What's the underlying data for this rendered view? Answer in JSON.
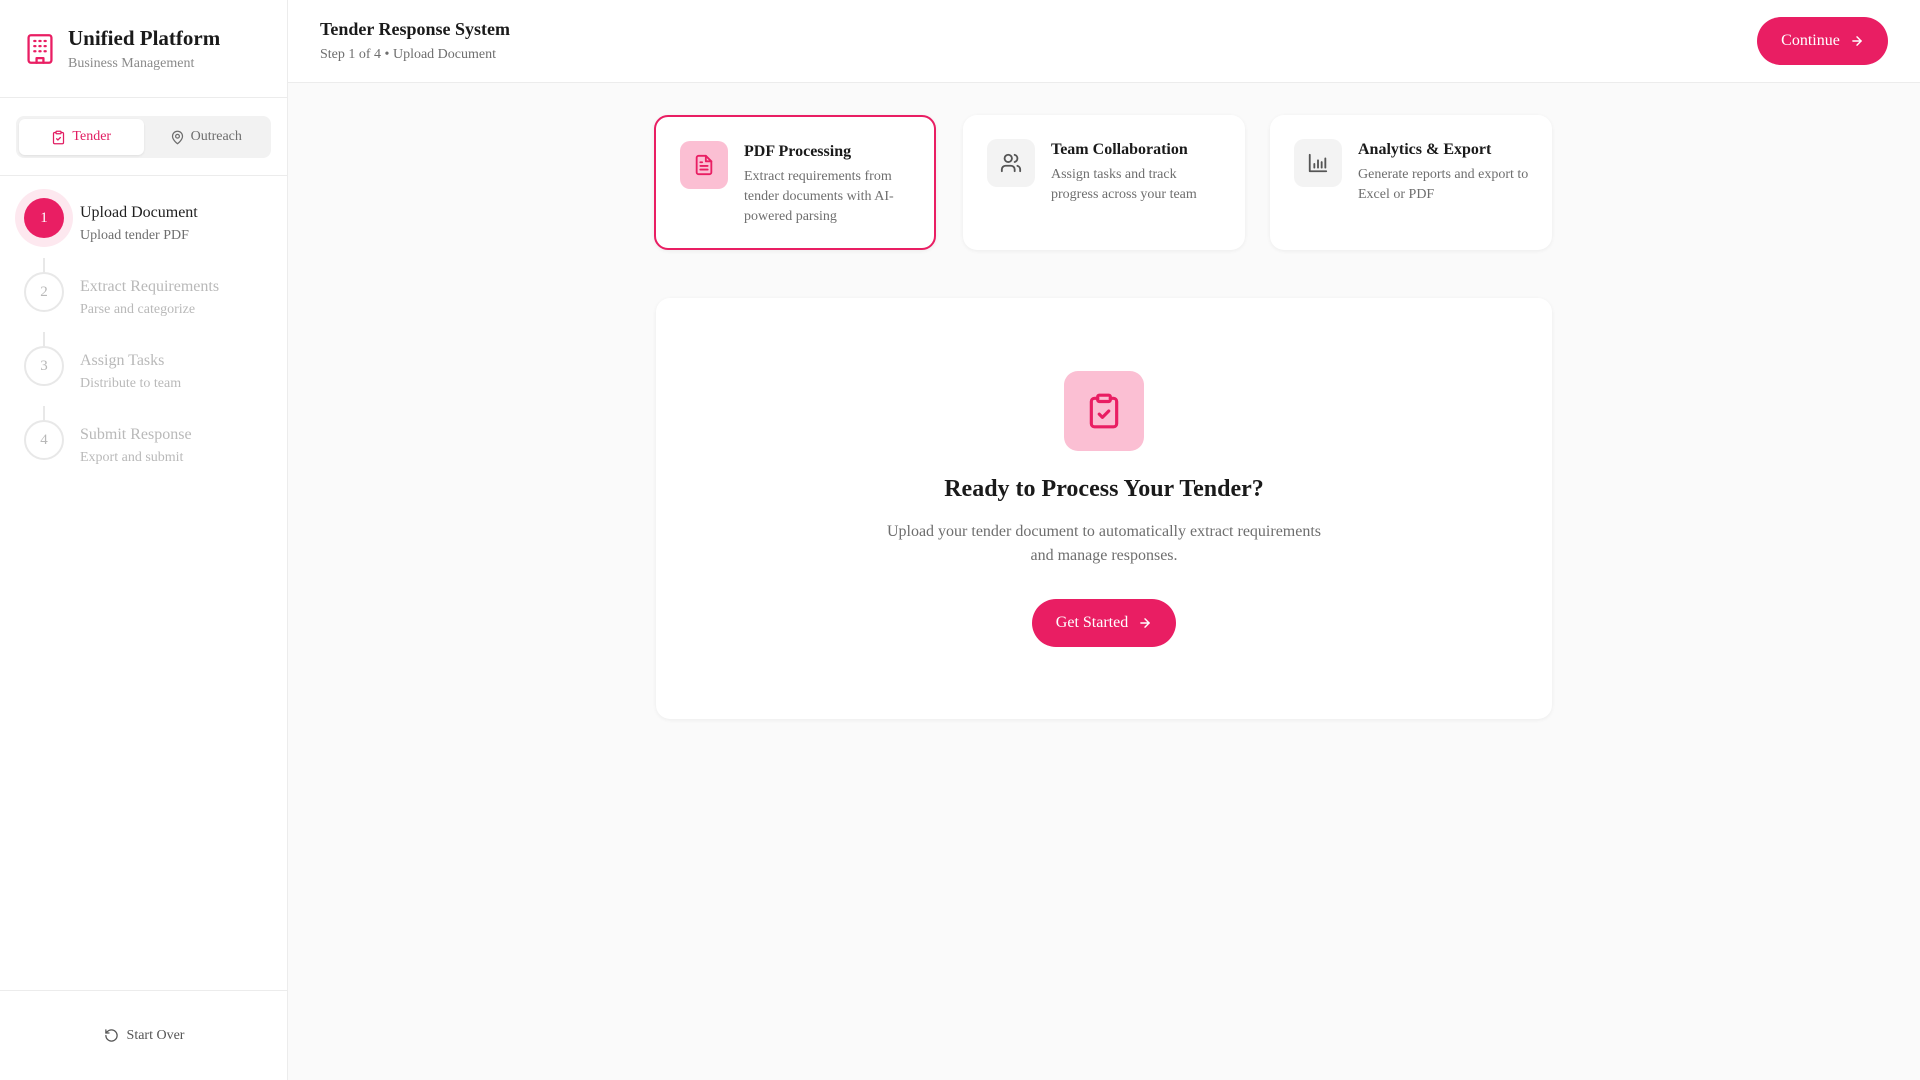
{
  "app": {
    "name": "Unified Platform",
    "subtitle": "Business Management",
    "brand_color": "#e91e63"
  },
  "module_switch": {
    "options": [
      {
        "label": "Tender",
        "icon": "clipboard-check-icon",
        "active": true
      },
      {
        "label": "Outreach",
        "icon": "map-pin-icon",
        "active": false
      }
    ]
  },
  "steps": [
    {
      "number": "1",
      "title": "Upload Document",
      "subtitle": "Upload tender PDF",
      "state": "active"
    },
    {
      "number": "2",
      "title": "Extract Requirements",
      "subtitle": "Parse and categorize",
      "state": "pending"
    },
    {
      "number": "3",
      "title": "Assign Tasks",
      "subtitle": "Distribute to team",
      "state": "pending"
    },
    {
      "number": "4",
      "title": "Submit Response",
      "subtitle": "Export and submit",
      "state": "pending"
    }
  ],
  "footer": {
    "start_over_label": "Start Over",
    "icon": "rotate-ccw-icon"
  },
  "header": {
    "title": "Tender Response System",
    "subtitle": "Step 1 of 4 • Upload Document",
    "continue_label": "Continue"
  },
  "features": [
    {
      "title": "PDF Processing",
      "description": "Extract requirements from tender documents with AI-powered parsing",
      "icon": "file-text-icon",
      "selected": true
    },
    {
      "title": "Team Collaboration",
      "description": "Assign tasks and track progress across your team",
      "icon": "users-icon",
      "selected": false
    },
    {
      "title": "Analytics & Export",
      "description": "Generate reports and export to Excel or PDF",
      "icon": "bar-chart-icon",
      "selected": false
    }
  ],
  "hero": {
    "icon": "clipboard-check-icon",
    "title": "Ready to Process Your Tender?",
    "description": "Upload your tender document to automatically extract requirements and manage responses.",
    "cta_label": "Get Started"
  }
}
